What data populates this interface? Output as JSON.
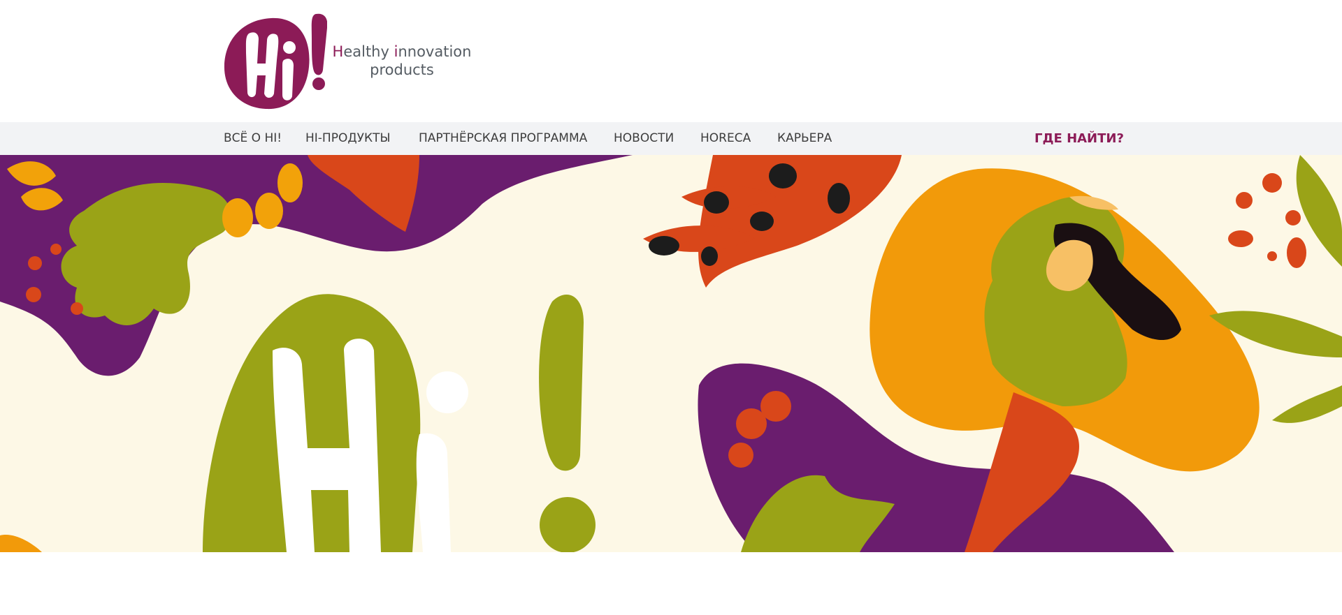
{
  "brand": {
    "logo_text": "Hi!",
    "tagline_line1_accent": "H",
    "tagline_line1_rest": "ealthy ",
    "tagline_line1_accent2": "i",
    "tagline_line1_end": "nnovation",
    "tagline_line2": "products"
  },
  "nav": {
    "items": [
      {
        "label": "ВСЁ О HI!"
      },
      {
        "label": "HI-ПРОДУКТЫ"
      },
      {
        "label": "ПАРТНЁРСКАЯ ПРОГРАММА"
      },
      {
        "label": "НОВОСТИ"
      },
      {
        "label": "HORECA"
      },
      {
        "label": "КАРЬЕРА"
      }
    ],
    "where_to_find": "ГДЕ НАЙТИ?"
  },
  "hero": {
    "logo_text": "Hi!"
  },
  "colors": {
    "brand": "#8c1b57",
    "purple": "#6a1d6e",
    "olive": "#9aa317",
    "orange": "#f29a0a",
    "red_orange": "#d9471a",
    "cream": "#fdf8e6"
  }
}
